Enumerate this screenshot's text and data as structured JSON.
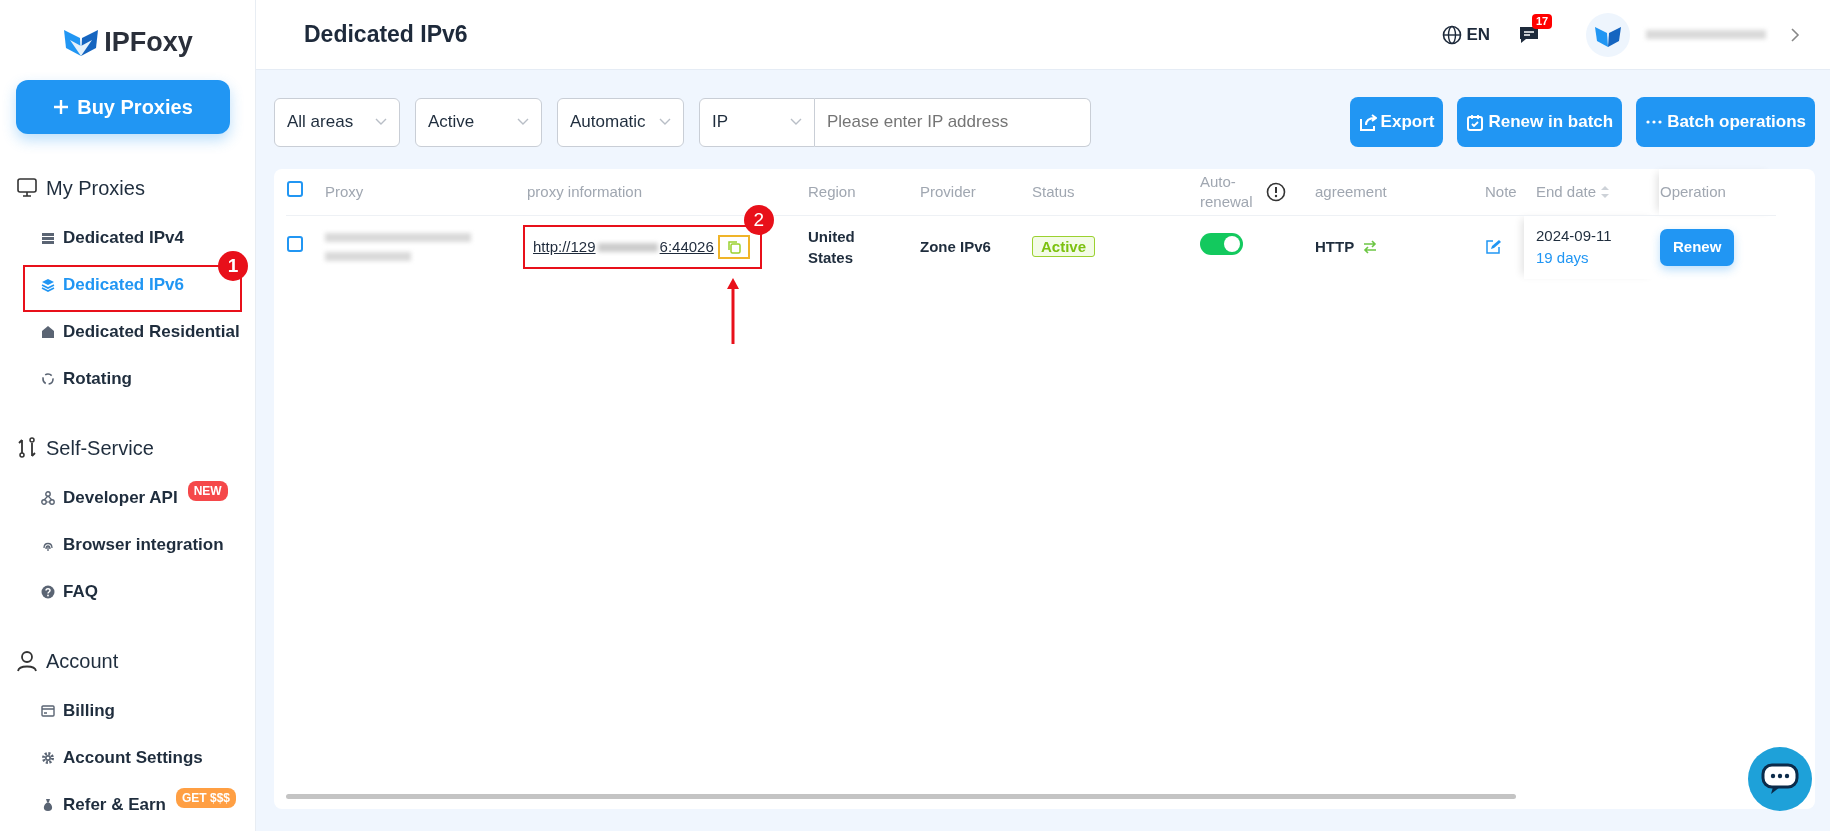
{
  "logo": {
    "text": "IPFoxy"
  },
  "buy_button": {
    "label": "Buy Proxies"
  },
  "sidebar": {
    "sections": [
      {
        "title": "My Proxies",
        "items": [
          {
            "label": "Dedicated IPv4",
            "selected": false
          },
          {
            "label": "Dedicated IPv6",
            "selected": true,
            "annotation": "1"
          },
          {
            "label": "Dedicated Residential",
            "selected": false
          },
          {
            "label": "Rotating",
            "selected": false
          }
        ]
      },
      {
        "title": "Self-Service",
        "items": [
          {
            "label": "Developer API",
            "selected": false,
            "badge": "NEW",
            "color": "#f5484a"
          },
          {
            "label": "Browser integration",
            "selected": false
          },
          {
            "label": "FAQ",
            "selected": false
          }
        ]
      },
      {
        "title": "Account",
        "items": [
          {
            "label": "Billing",
            "selected": false
          },
          {
            "label": "Account Settings",
            "selected": false
          },
          {
            "label": "Refer & Earn",
            "selected": false,
            "badge": "GET $$$",
            "color": "#ff9f43"
          }
        ]
      }
    ]
  },
  "header": {
    "title": "Dedicated IPv6",
    "language": "EN",
    "message_count": "17"
  },
  "filters": [
    {
      "value": "All areas"
    },
    {
      "value": "Active"
    },
    {
      "value": "Automatic"
    }
  ],
  "search": {
    "type": "IP",
    "placeholder": "Please enter IP address"
  },
  "actions": [
    "Export",
    "Renew in batch",
    "Batch operations"
  ],
  "table": {
    "all_checked": false,
    "columns": [
      "Proxy",
      "proxy information",
      "Region",
      "Provider",
      "Status",
      "Auto-renewal",
      "agreement",
      "Note",
      "End date",
      "Operation"
    ],
    "rows": [
      {
        "checked": false,
        "proxy_info_prefix": "http://129",
        "proxy_info_suffix": "6:44026",
        "annotation": "2",
        "region": "United States",
        "provider": "Zone IPv6",
        "status": "Active",
        "auto_renewal": true,
        "agreement": "HTTP",
        "end_date": "2024-09-11",
        "remaining": "19 days",
        "action": "Renew"
      }
    ]
  }
}
